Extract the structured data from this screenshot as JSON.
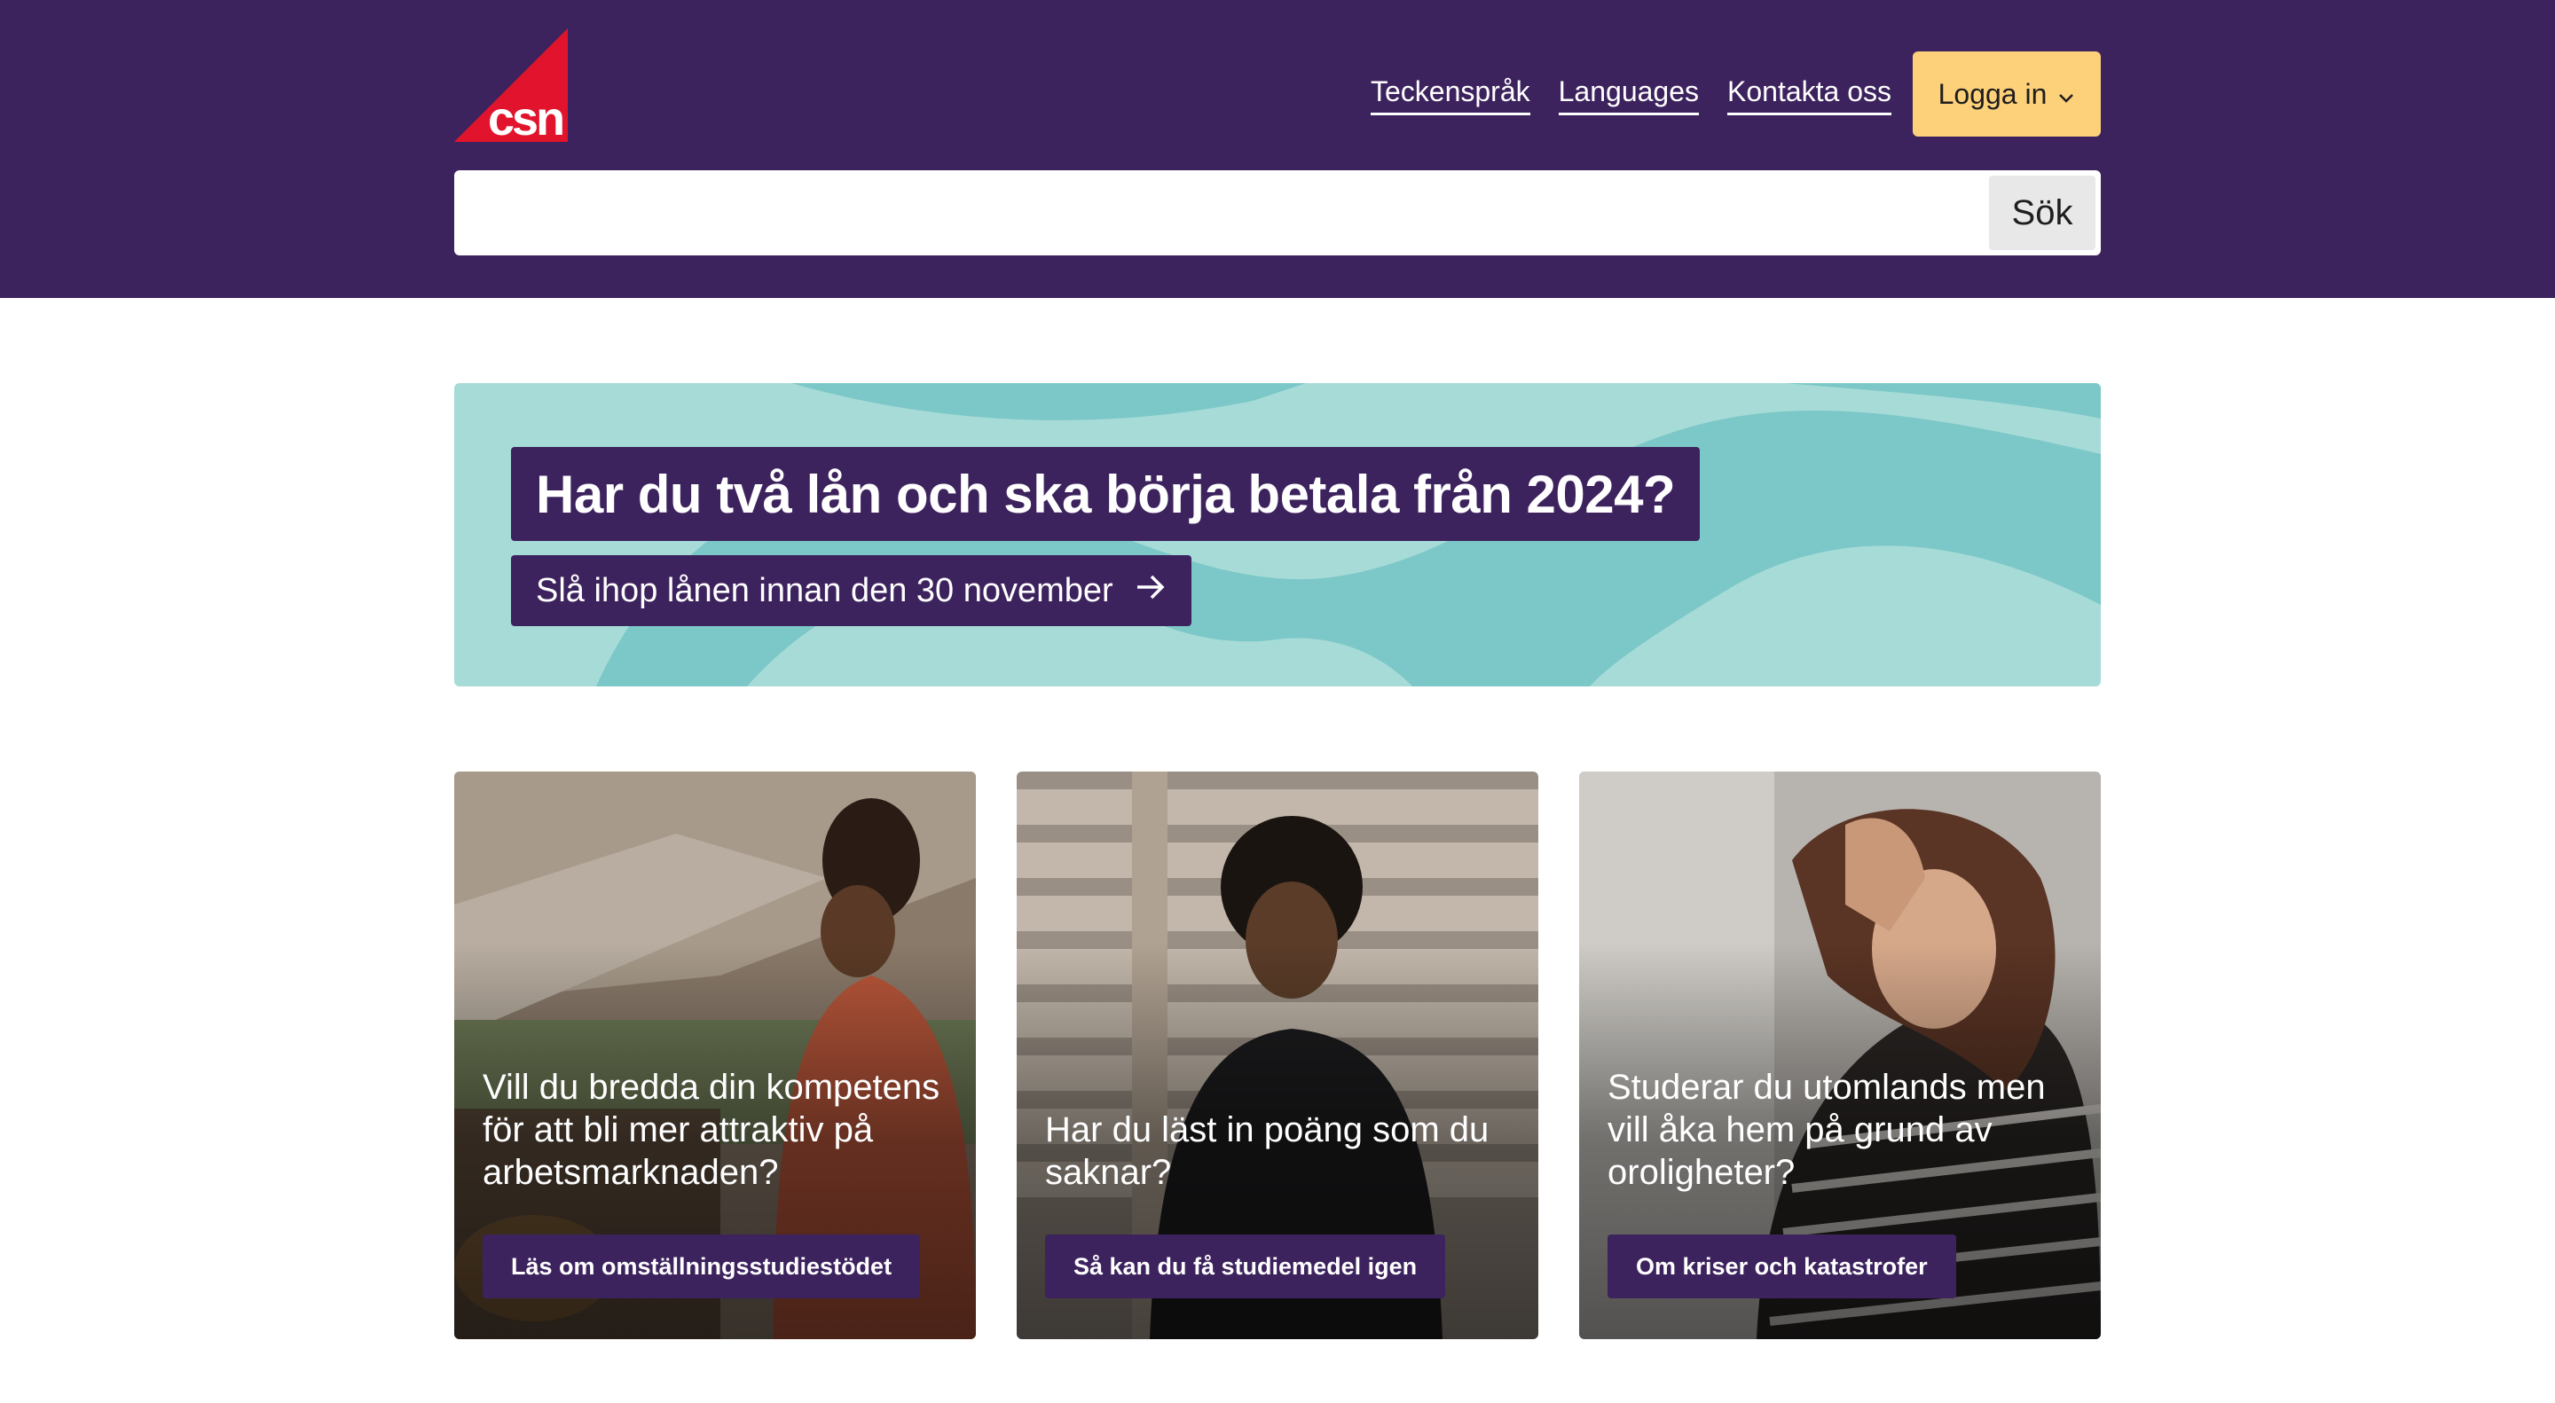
{
  "brand": {
    "logo_text": "csn",
    "colors": {
      "primary": "#3d235e",
      "accent_red": "#e2142d",
      "login_yellow": "#fdd07a",
      "banner_teal": "#a6dbd8",
      "banner_teal_dark": "#7cc7c7"
    }
  },
  "header": {
    "nav": [
      {
        "label": "Teckenspråk"
      },
      {
        "label": "Languages"
      },
      {
        "label": "Kontakta oss"
      }
    ],
    "login": {
      "label": "Logga in",
      "icon": "chevron-down-icon"
    },
    "search": {
      "placeholder": "",
      "value": "",
      "button_label": "Sök"
    }
  },
  "banner": {
    "title": "Har du två lån och ska börja betala från 2024?",
    "link_label": "Slå ihop lånen innan den 30 november",
    "link_icon": "arrow-right-icon"
  },
  "cards": [
    {
      "question": "Vill du bredda din kompetens för att bli mer attraktiv på arbetsmarknaden?",
      "cta": "Läs om omställningsstudiestödet",
      "image": "woman-smiling-outdoor-photo"
    },
    {
      "question": "Har du läst in poäng som du saknar?",
      "cta": "Så kan du få studiemedel igen",
      "image": "man-by-wooden-wall-photo"
    },
    {
      "question": "Studerar du utomlands men vill åka hem på grund av oroligheter?",
      "cta": "Om kriser och katastrofer",
      "image": "worried-woman-photo"
    }
  ]
}
